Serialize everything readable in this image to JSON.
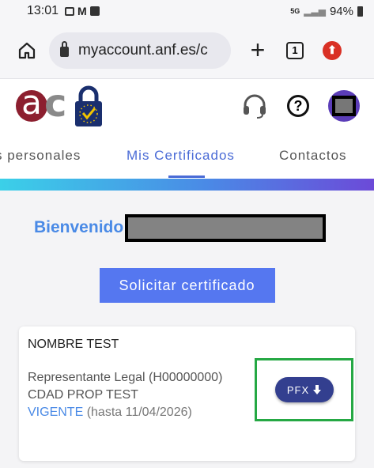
{
  "status_bar": {
    "time": "13:01",
    "network": "5G",
    "battery": "94%"
  },
  "browser": {
    "url": "myaccount.anf.es/c",
    "tab_count": "1",
    "plus_label": "+"
  },
  "header": {
    "help_glyph": "?"
  },
  "tabs": [
    {
      "label": "s personales"
    },
    {
      "label": "Mis Certificados"
    },
    {
      "label": "Contactos"
    }
  ],
  "welcome": {
    "label": "Bienvenido"
  },
  "cta": {
    "label": "Solicitar certificado"
  },
  "certificate": {
    "name": "NOMBRE TEST",
    "role": "Representante Legal (H00000000)",
    "entity": "CDAD PROP TEST",
    "status": "VIGENTE",
    "valid_until": "(hasta 11/04/2026)",
    "download_label": "PFX"
  },
  "colors": {
    "accent": "#4a6bd6",
    "button": "#5577f0",
    "pfx_button": "#333f8f",
    "highlight": "#25a844"
  }
}
